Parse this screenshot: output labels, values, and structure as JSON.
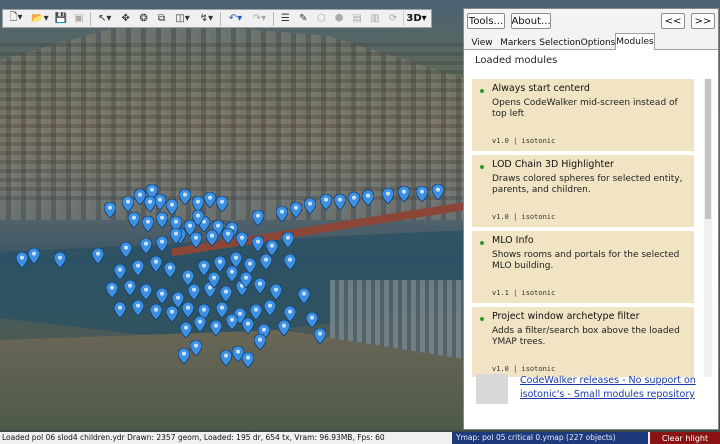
{
  "toolbar": {
    "items": [
      {
        "icon": "new-file-icon",
        "dropdown": true
      },
      {
        "icon": "open-folder-icon",
        "dropdown": true
      },
      {
        "icon": "save-icon"
      },
      {
        "icon": "save-all-icon"
      },
      {
        "icon": "pointer-select-icon",
        "dropdown": true
      },
      {
        "icon": "move-icon"
      },
      {
        "icon": "rotate-icon"
      },
      {
        "icon": "scale-icon"
      },
      {
        "icon": "transform-space-icon",
        "dropdown": true
      },
      {
        "icon": "snap-icon",
        "dropdown": true
      },
      {
        "icon": "undo-icon",
        "dropdown": true
      },
      {
        "icon": "redo-icon",
        "dropdown": true
      },
      {
        "icon": "info-icon"
      },
      {
        "icon": "paint-icon"
      },
      {
        "icon": "add-entity-icon"
      },
      {
        "icon": "copy-entity-icon"
      },
      {
        "icon": "paste-entity-icon"
      },
      {
        "icon": "delete-entity-icon"
      },
      {
        "icon": "refresh-icon"
      }
    ],
    "mode_label": "3D"
  },
  "panel": {
    "tools_label": "Tools...",
    "about_label": "About...",
    "collapse_left_label": "<<",
    "collapse_right_label": ">>",
    "tabs": [
      "View",
      "Markers",
      "Selection",
      "Options",
      "Modules"
    ],
    "active_tab": "Modules",
    "section_title": "Loaded modules",
    "modules": [
      {
        "name": "Always start centerd",
        "description": "Opens CodeWalker mid-screen instead of top left",
        "version": "v1.0  |  isotonic"
      },
      {
        "name": "LOD Chain 3D Highlighter",
        "description": "Draws colored spheres for selected entity, parents, and children.",
        "version": "v1.0  |  isotonic"
      },
      {
        "name": "MLO Info",
        "description": "Shows rooms and portals for the selected MLO building.",
        "version": "v1.1  |  isotonic"
      },
      {
        "name": "Project window archetype filter",
        "description": "Adds a filter/search box above the loaded YMAP trees.",
        "version": "v1.0  |  isotonic"
      }
    ],
    "links": [
      "CodeWalker releases - No support on",
      "isotonic's - Small modules repository"
    ]
  },
  "status": {
    "left_text": "Loaded pol 06 slod4 children.ydr Drawn: 2357 geom, Loaded: 195 dr, 654 tx, Vram: 96.93MB, Fps: 60",
    "ymap_text": "Ymap: pol 05 critical 0.ymap (227 objects)",
    "clear_button": "Clear hlight"
  },
  "colors": {
    "marker": "#3d8fe0",
    "module_bg": "#f0e4c4",
    "status_ymap_bg": "#1e3a7a",
    "clear_button_bg": "#8a1414",
    "link": "#1a3aa8"
  }
}
